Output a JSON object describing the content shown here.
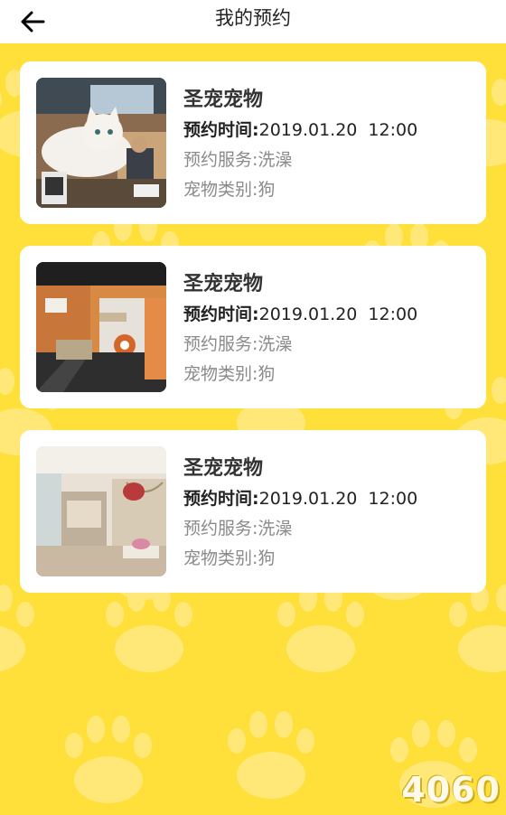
{
  "header": {
    "title": "我的预约",
    "back_icon": "arrow-left-icon"
  },
  "colors": {
    "background": "#FFDF3A",
    "paw_pattern": "#FFE877",
    "card": "#FFFFFF"
  },
  "appointments": [
    {
      "shop_name": "圣宠宠物",
      "time_label": "预约时间:",
      "date": "2019.01.20",
      "time": "12:00",
      "service_label": "预约服务:",
      "service": "洗澡",
      "pet_label": "宠物类别:",
      "pet": "狗",
      "photo": "cat-in-shop-photo"
    },
    {
      "shop_name": "圣宠宠物",
      "time_label": "预约时间:",
      "date": "2019.01.20",
      "time": "12:00",
      "service_label": "预约服务:",
      "service": "洗澡",
      "pet_label": "宠物类别:",
      "pet": "狗",
      "photo": "pet-shop-interior-photo"
    },
    {
      "shop_name": "圣宠宠物",
      "time_label": "预约时间:",
      "date": "2019.01.20",
      "time": "12:00",
      "service_label": "预约服务:",
      "service": "洗澡",
      "pet_label": "宠物类别:",
      "pet": "狗",
      "photo": "pet-store-lounge-photo"
    }
  ],
  "watermark": "4060"
}
